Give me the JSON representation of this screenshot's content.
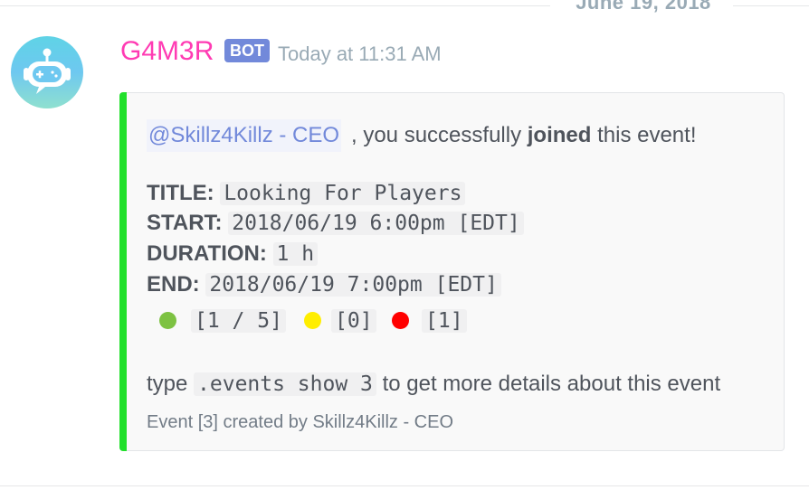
{
  "divider": {
    "date": "June 19, 2018"
  },
  "message": {
    "username": "G4M3R",
    "bot_tag": "BOT",
    "timestamp": "Today at 11:31 AM"
  },
  "embed": {
    "accent_color": "#21e02b",
    "mention": "@Skillz4Killz - CEO",
    "joined_prefix": ", you successfully ",
    "joined_word": "joined",
    "joined_suffix": " this event!",
    "title_label": "TITLE:",
    "title_value": "Looking For Players",
    "start_label": "START:",
    "start_value": "2018/06/19 6:00pm [EDT]",
    "duration_label": "DURATION:",
    "duration_value": "1 h",
    "end_label": "END:",
    "end_value": "2018/06/19 7:00pm [EDT]",
    "counts": [
      {
        "icon": "green-circle-icon",
        "color": "#7dc242",
        "value": "[1 / 5]"
      },
      {
        "icon": "yellow-circle-icon",
        "color": "#ffee00",
        "value": "[0]"
      },
      {
        "icon": "red-circle-icon",
        "color": "#ff0000",
        "value": "[1]"
      }
    ],
    "type_prefix": "type ",
    "command": ".events show 3",
    "type_suffix": " to get more details about this event",
    "footer": "Event [3] created by Skillz4Killz - CEO"
  },
  "colors": {
    "username": "#ff3bb3",
    "bot_tag": "#7289da",
    "mention": "#7289da"
  }
}
